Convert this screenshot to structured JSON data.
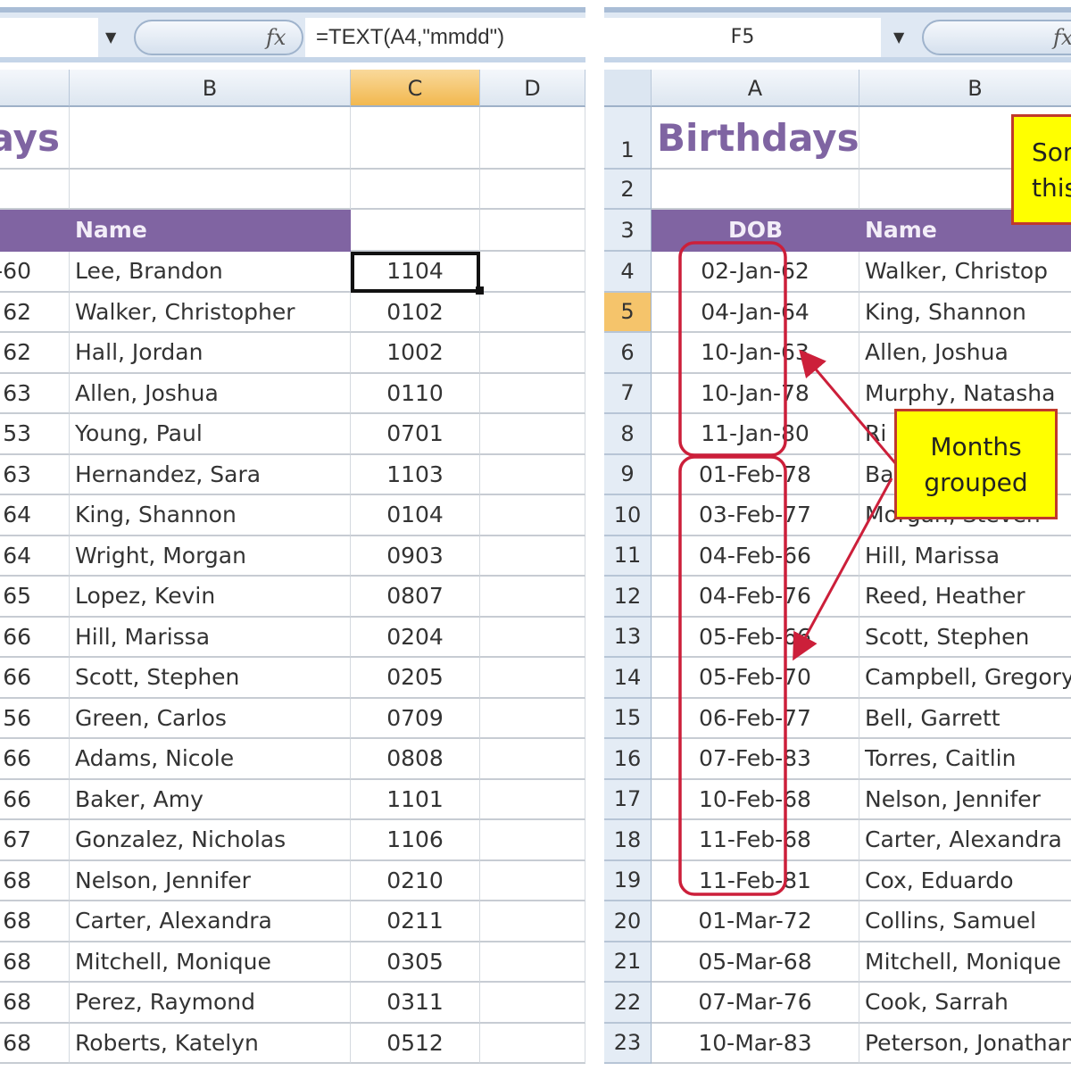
{
  "left": {
    "formula_bar": {
      "name_box": "",
      "formula": "=TEXT(A4,\"mmdd\")",
      "fx_label": "fx"
    },
    "columns": [
      "",
      "B",
      "C",
      "D"
    ],
    "selected_column": "C",
    "title_fragment": "ays",
    "header": {
      "name": "Name"
    },
    "rows": [
      {
        "a": "-60",
        "name": "Lee, Brandon",
        "key": "1104"
      },
      {
        "a": "62",
        "name": "Walker, Christopher",
        "key": "0102"
      },
      {
        "a": "62",
        "name": "Hall, Jordan",
        "key": "1002"
      },
      {
        "a": "63",
        "name": "Allen, Joshua",
        "key": "0110"
      },
      {
        "a": "53",
        "name": "Young, Paul",
        "key": "0701"
      },
      {
        "a": "63",
        "name": "Hernandez, Sara",
        "key": "1103"
      },
      {
        "a": "64",
        "name": "King, Shannon",
        "key": "0104"
      },
      {
        "a": "64",
        "name": "Wright, Morgan",
        "key": "0903"
      },
      {
        "a": "65",
        "name": "Lopez, Kevin",
        "key": "0807"
      },
      {
        "a": "66",
        "name": "Hill, Marissa",
        "key": "0204"
      },
      {
        "a": "66",
        "name": "Scott, Stephen",
        "key": "0205"
      },
      {
        "a": "56",
        "name": "Green, Carlos",
        "key": "0709"
      },
      {
        "a": "66",
        "name": "Adams, Nicole",
        "key": "0808"
      },
      {
        "a": "66",
        "name": "Baker, Amy",
        "key": "1101"
      },
      {
        "a": "67",
        "name": "Gonzalez, Nicholas",
        "key": "1106"
      },
      {
        "a": "68",
        "name": "Nelson, Jennifer",
        "key": "0210"
      },
      {
        "a": "68",
        "name": "Carter, Alexandra",
        "key": "0211"
      },
      {
        "a": "68",
        "name": "Mitchell, Monique",
        "key": "0305"
      },
      {
        "a": "68",
        "name": "Perez, Raymond",
        "key": "0311"
      },
      {
        "a": "68",
        "name": "Roberts, Katelyn",
        "key": "0512"
      }
    ]
  },
  "right": {
    "formula_bar": {
      "name_box": "F5",
      "fx_label": "fx"
    },
    "columns": [
      "A",
      "B"
    ],
    "title": "Birthdays",
    "header": {
      "dob": "DOB",
      "name": "Name"
    },
    "selected_row": "5",
    "row_numbers": [
      "1",
      "2",
      "3",
      "4",
      "5",
      "6",
      "7",
      "8",
      "9",
      "10",
      "11",
      "12",
      "13",
      "14",
      "15",
      "16",
      "17",
      "18",
      "19",
      "20",
      "21",
      "22",
      "23"
    ],
    "rows": [
      {
        "dob": "02-Jan-62",
        "name": "Walker, Christop"
      },
      {
        "dob": "04-Jan-64",
        "name": "King, Shannon"
      },
      {
        "dob": "10-Jan-63",
        "name": "Allen, Joshua"
      },
      {
        "dob": "10-Jan-78",
        "name": "Murphy, Natasha"
      },
      {
        "dob": "11-Jan-80",
        "name": "Ri"
      },
      {
        "dob": "01-Feb-78",
        "name": "Ba"
      },
      {
        "dob": "03-Feb-77",
        "name": "Morgan, Steven"
      },
      {
        "dob": "04-Feb-66",
        "name": "Hill, Marissa"
      },
      {
        "dob": "04-Feb-76",
        "name": "Reed, Heather"
      },
      {
        "dob": "05-Feb-66",
        "name": "Scott, Stephen"
      },
      {
        "dob": "05-Feb-70",
        "name": "Campbell, Gregory"
      },
      {
        "dob": "06-Feb-77",
        "name": "Bell, Garrett"
      },
      {
        "dob": "07-Feb-83",
        "name": "Torres, Caitlin"
      },
      {
        "dob": "10-Feb-68",
        "name": "Nelson, Jennifer"
      },
      {
        "dob": "11-Feb-68",
        "name": "Carter, Alexandra"
      },
      {
        "dob": "11-Feb-81",
        "name": "Cox, Eduardo"
      },
      {
        "dob": "01-Mar-72",
        "name": "Collins, Samuel"
      },
      {
        "dob": "05-Mar-68",
        "name": "Mitchell, Monique"
      },
      {
        "dob": "07-Mar-76",
        "name": "Cook, Sarrah"
      },
      {
        "dob": "10-Mar-83",
        "name": "Peterson, Jonathan"
      }
    ],
    "callouts": {
      "sort_line1": "Sor",
      "sort_line2": "this",
      "months_line1": "Months",
      "months_line2": "grouped"
    }
  },
  "colors": {
    "header_purple": "#8064a2",
    "title_purple": "#7f64a2",
    "selected_header": "#f5c46b",
    "callout_fill": "#ffff00",
    "annotation_red": "#cc1f3a"
  }
}
